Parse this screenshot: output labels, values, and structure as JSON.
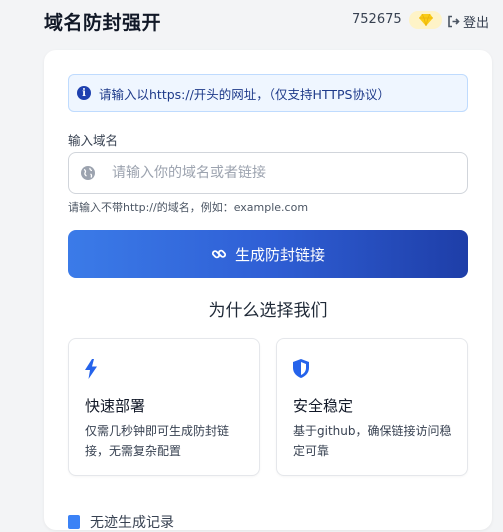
{
  "header": {
    "title": "域名防封强开",
    "points": "752675",
    "logout_label": "登出"
  },
  "notice": {
    "text": "请输入以https://开头的网址，（仅支持HTTPS协议）"
  },
  "form": {
    "label": "输入域名",
    "placeholder": "请输入你的域名或者链接",
    "value": "",
    "hint": "请输入不带http://的域名，例如：example.com",
    "submit_label": "生成防封链接"
  },
  "why": {
    "title": "为什么选择我们",
    "features": [
      {
        "title": "快速部署",
        "desc": "仅需几秒钟即可生成防封链接，无需复杂配置",
        "icon": "bolt-icon"
      },
      {
        "title": "安全稳定",
        "desc": "基于github，确保链接访问稳定可靠",
        "icon": "shield-icon"
      }
    ]
  },
  "more": {
    "text": "无迹生成记录"
  },
  "colors": {
    "accent": "#2f5fd5",
    "notice_bg": "#eff6ff",
    "notice_text": "#1e3a8a",
    "badge_bg": "#fef3c7"
  }
}
